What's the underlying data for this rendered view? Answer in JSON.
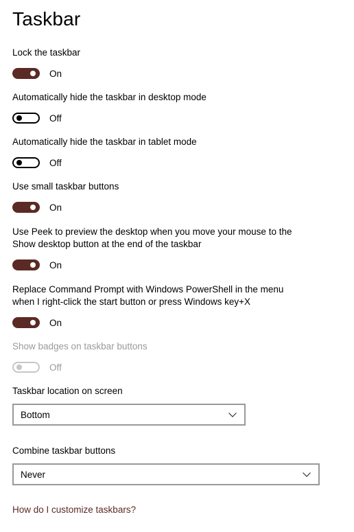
{
  "page": {
    "title": "Taskbar"
  },
  "settings": [
    {
      "label": "Lock the taskbar",
      "state": "On"
    },
    {
      "label": "Automatically hide the taskbar in desktop mode",
      "state": "Off"
    },
    {
      "label": "Automatically hide the taskbar in tablet mode",
      "state": "Off"
    },
    {
      "label": "Use small taskbar buttons",
      "state": "On"
    },
    {
      "label_line1": "Use Peek to preview the desktop when you move your mouse to the",
      "label_line2": "Show desktop button at the end of the taskbar",
      "state": "On"
    },
    {
      "label_line1": "Replace Command Prompt with Windows PowerShell in the menu",
      "label_line2": "when I right-click the start button or press Windows key+X",
      "state": "On"
    },
    {
      "label": "Show badges on taskbar buttons",
      "state": "Off",
      "disabled": true
    }
  ],
  "location": {
    "label": "Taskbar location on screen",
    "value": "Bottom"
  },
  "combine": {
    "label": "Combine taskbar buttons",
    "value": "Never"
  },
  "help": {
    "link": "How do I customize taskbars?"
  },
  "colors": {
    "accent": "#5b2a24",
    "disabled": "#9a9a9a"
  },
  "icons": {
    "dropdown": "chevron-down-icon"
  }
}
